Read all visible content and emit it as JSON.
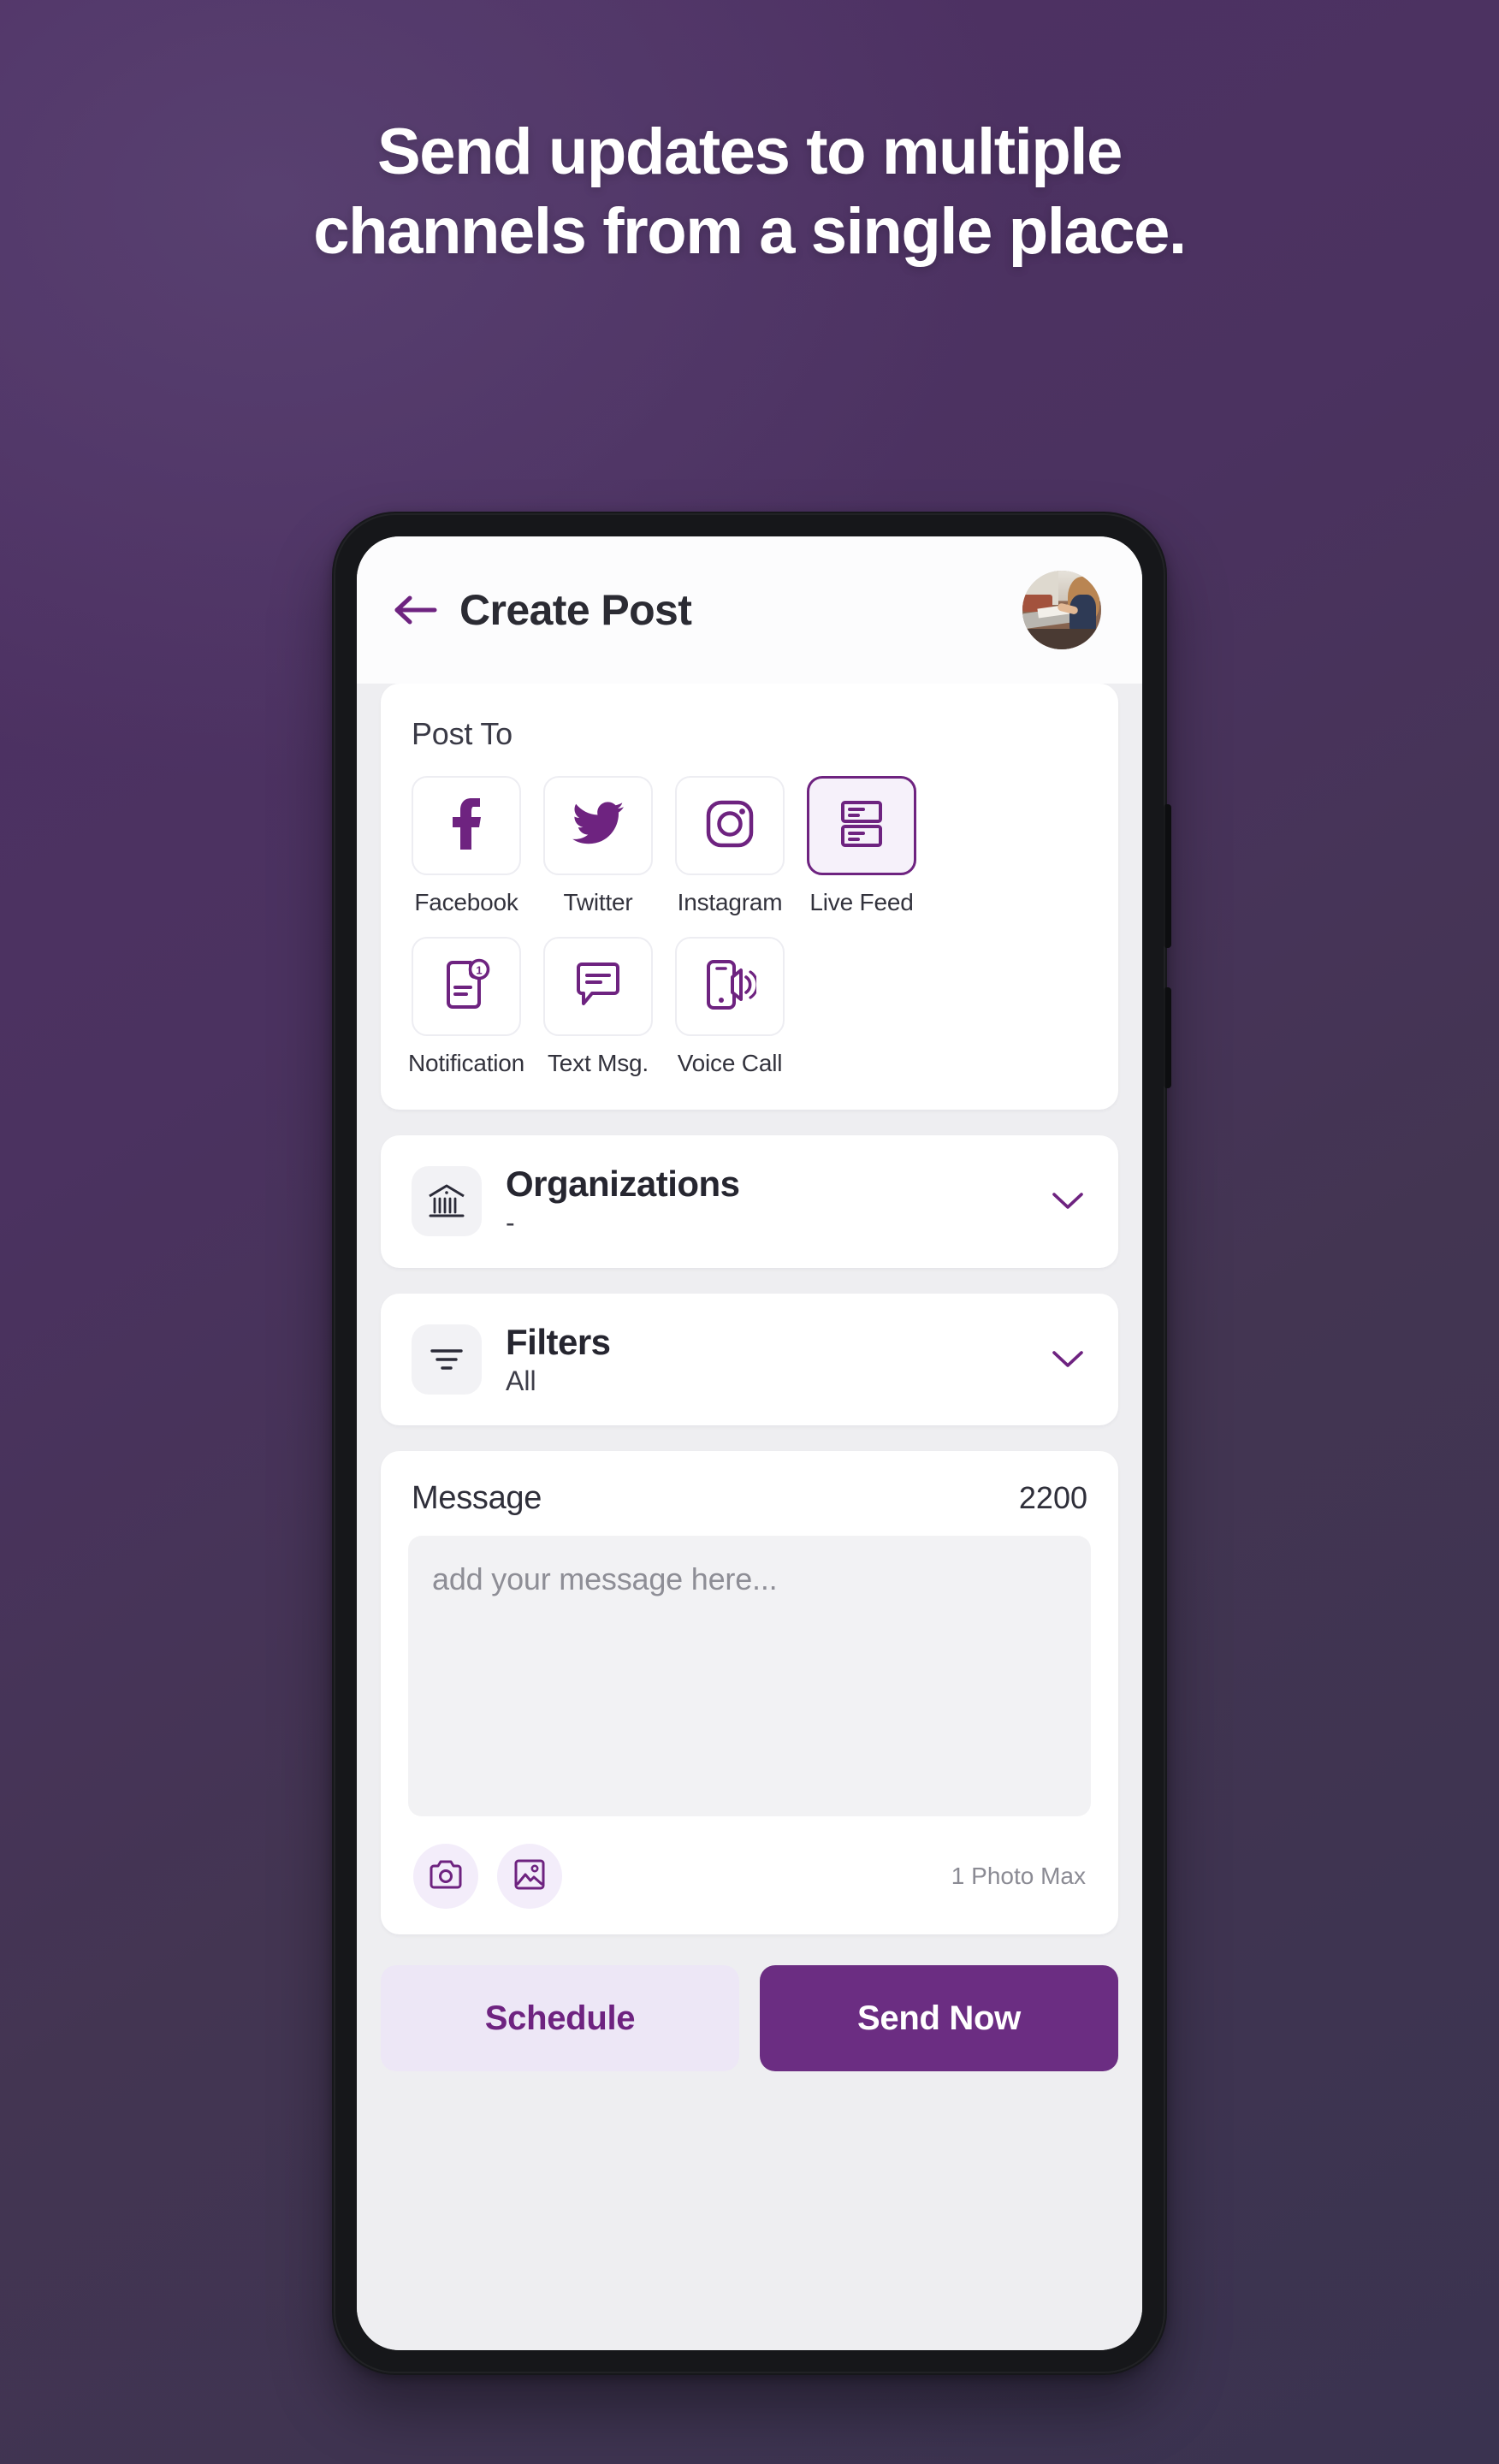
{
  "promo": {
    "headline_line1": "Send updates to multiple",
    "headline_line2": "channels from a single place."
  },
  "colors": {
    "background_top": "#4F3065",
    "background_bottom": "#3A3350",
    "accent_purple": "#6E2380",
    "accent_button": "#6B2D82",
    "accent_light": "#EDE7F6",
    "screen_background": "#EEEEF1",
    "card_background": "#FFFFFF",
    "input_background": "#F2F2F4"
  },
  "header": {
    "back_icon": "arrow-left-icon",
    "title": "Create Post",
    "avatar_icon": "user-avatar"
  },
  "post_to": {
    "label": "Post To",
    "channels": [
      {
        "label": "Facebook",
        "icon": "facebook-icon",
        "selected": false
      },
      {
        "label": "Twitter",
        "icon": "twitter-icon",
        "selected": false
      },
      {
        "label": "Instagram",
        "icon": "instagram-icon",
        "selected": false
      },
      {
        "label": "Live Feed",
        "icon": "live-feed-icon",
        "selected": true
      },
      {
        "label": "Notification",
        "icon": "notification-icon",
        "selected": false
      },
      {
        "label": "Text Msg.",
        "icon": "text-message-icon",
        "selected": false
      },
      {
        "label": "Voice Call",
        "icon": "voice-call-icon",
        "selected": false
      }
    ]
  },
  "organizations": {
    "title": "Organizations",
    "value": "-",
    "icon": "bank-icon",
    "chevron": "chevron-down-icon"
  },
  "filters": {
    "title": "Filters",
    "value": "All",
    "icon": "filter-icon",
    "chevron": "chevron-down-icon"
  },
  "message": {
    "label": "Message",
    "char_count": "2200",
    "placeholder": "add your message here...",
    "value": "",
    "camera_icon": "camera-icon",
    "gallery_icon": "image-icon",
    "photo_limit": "1 Photo Max"
  },
  "actions": {
    "schedule_label": "Schedule",
    "send_label": "Send Now"
  }
}
